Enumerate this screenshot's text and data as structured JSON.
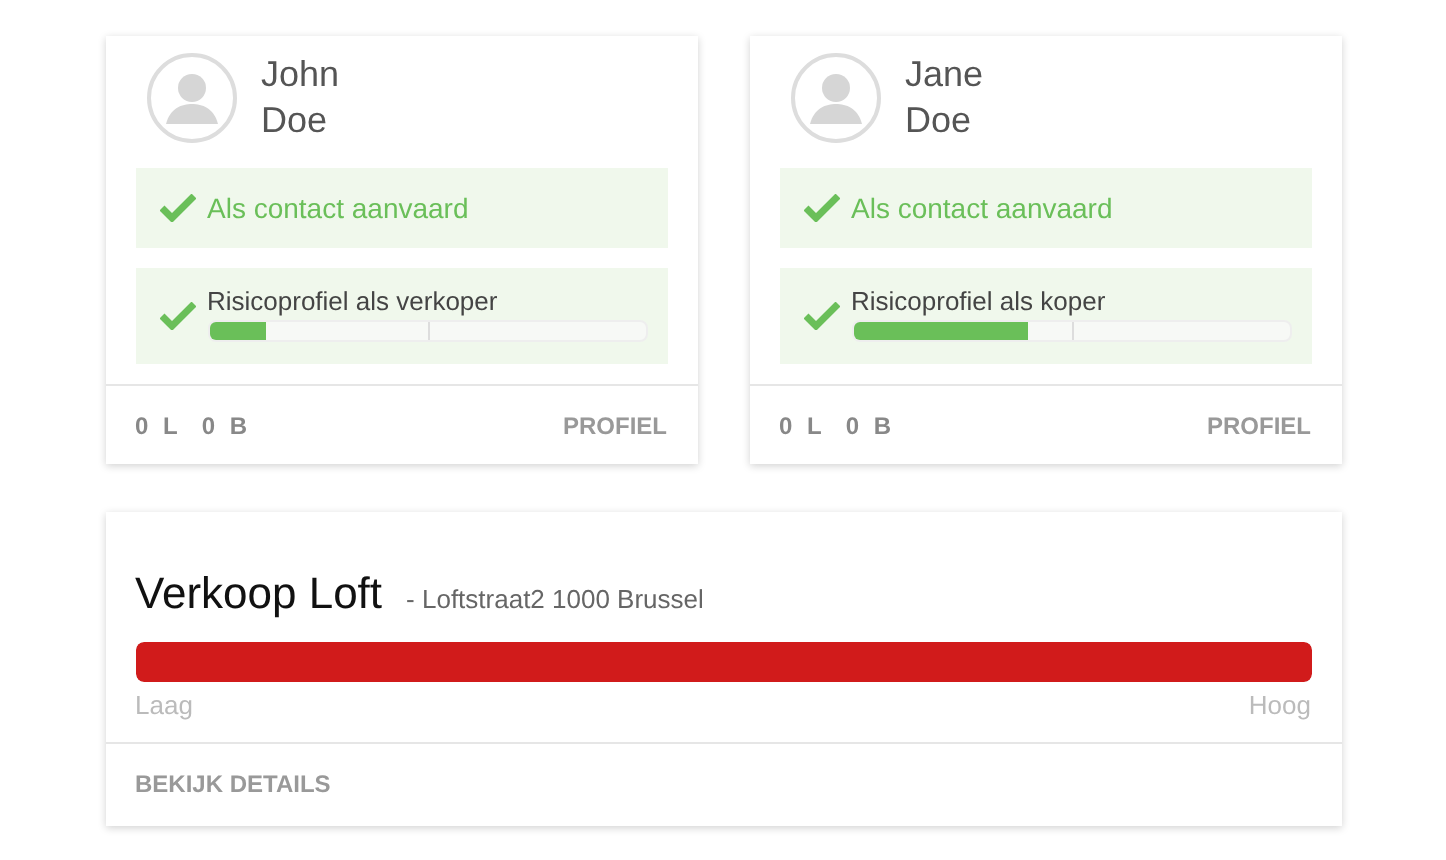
{
  "contacts": [
    {
      "first_name": "John",
      "last_name": "Doe",
      "accepted": true,
      "accepted_label": "Als contact aanvaard",
      "risk": {
        "done": true,
        "label": "Risicoprofiel als verkoper",
        "level": 0.13
      },
      "counts": [
        "0 L",
        "0 B"
      ],
      "action": "PROFIEL"
    },
    {
      "first_name": "Jane",
      "last_name": "Doe",
      "accepted": true,
      "accepted_label": "Als contact aanvaard",
      "risk": {
        "done": true,
        "label": "Risicoprofiel als koper",
        "level": 0.4
      },
      "counts": [
        "0 L",
        "0 B"
      ],
      "action": "PROFIEL"
    }
  ],
  "listing": {
    "title": "Verkoop Loft",
    "address": "- Loftstraat2  1000 Brussel",
    "risk": {
      "level": 1,
      "color": "#d11b1b",
      "low": "Laag",
      "high": "Hoog"
    },
    "action": "BEKIJK DETAILS"
  }
}
